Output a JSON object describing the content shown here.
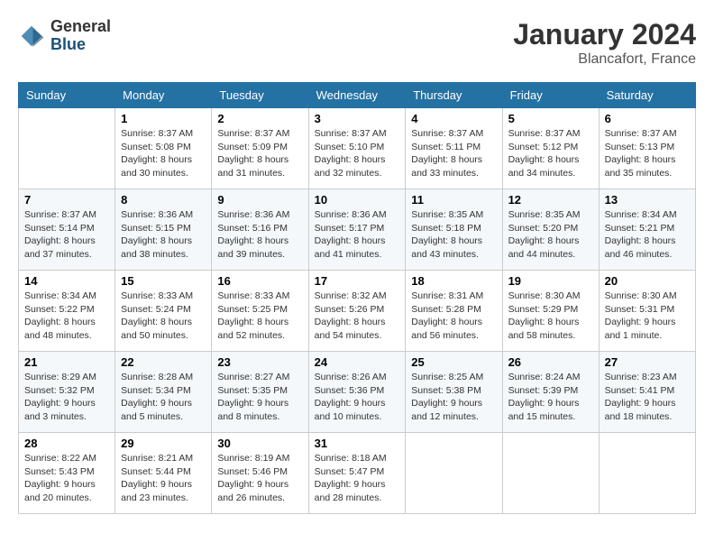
{
  "header": {
    "logo_general": "General",
    "logo_blue": "Blue",
    "month_title": "January 2024",
    "location": "Blancafort, France"
  },
  "days_of_week": [
    "Sunday",
    "Monday",
    "Tuesday",
    "Wednesday",
    "Thursday",
    "Friday",
    "Saturday"
  ],
  "weeks": [
    [
      {
        "day": "",
        "info": ""
      },
      {
        "day": "1",
        "info": "Sunrise: 8:37 AM\nSunset: 5:08 PM\nDaylight: 8 hours\nand 30 minutes."
      },
      {
        "day": "2",
        "info": "Sunrise: 8:37 AM\nSunset: 5:09 PM\nDaylight: 8 hours\nand 31 minutes."
      },
      {
        "day": "3",
        "info": "Sunrise: 8:37 AM\nSunset: 5:10 PM\nDaylight: 8 hours\nand 32 minutes."
      },
      {
        "day": "4",
        "info": "Sunrise: 8:37 AM\nSunset: 5:11 PM\nDaylight: 8 hours\nand 33 minutes."
      },
      {
        "day": "5",
        "info": "Sunrise: 8:37 AM\nSunset: 5:12 PM\nDaylight: 8 hours\nand 34 minutes."
      },
      {
        "day": "6",
        "info": "Sunrise: 8:37 AM\nSunset: 5:13 PM\nDaylight: 8 hours\nand 35 minutes."
      }
    ],
    [
      {
        "day": "7",
        "info": "Sunrise: 8:37 AM\nSunset: 5:14 PM\nDaylight: 8 hours\nand 37 minutes."
      },
      {
        "day": "8",
        "info": "Sunrise: 8:36 AM\nSunset: 5:15 PM\nDaylight: 8 hours\nand 38 minutes."
      },
      {
        "day": "9",
        "info": "Sunrise: 8:36 AM\nSunset: 5:16 PM\nDaylight: 8 hours\nand 39 minutes."
      },
      {
        "day": "10",
        "info": "Sunrise: 8:36 AM\nSunset: 5:17 PM\nDaylight: 8 hours\nand 41 minutes."
      },
      {
        "day": "11",
        "info": "Sunrise: 8:35 AM\nSunset: 5:18 PM\nDaylight: 8 hours\nand 43 minutes."
      },
      {
        "day": "12",
        "info": "Sunrise: 8:35 AM\nSunset: 5:20 PM\nDaylight: 8 hours\nand 44 minutes."
      },
      {
        "day": "13",
        "info": "Sunrise: 8:34 AM\nSunset: 5:21 PM\nDaylight: 8 hours\nand 46 minutes."
      }
    ],
    [
      {
        "day": "14",
        "info": "Sunrise: 8:34 AM\nSunset: 5:22 PM\nDaylight: 8 hours\nand 48 minutes."
      },
      {
        "day": "15",
        "info": "Sunrise: 8:33 AM\nSunset: 5:24 PM\nDaylight: 8 hours\nand 50 minutes."
      },
      {
        "day": "16",
        "info": "Sunrise: 8:33 AM\nSunset: 5:25 PM\nDaylight: 8 hours\nand 52 minutes."
      },
      {
        "day": "17",
        "info": "Sunrise: 8:32 AM\nSunset: 5:26 PM\nDaylight: 8 hours\nand 54 minutes."
      },
      {
        "day": "18",
        "info": "Sunrise: 8:31 AM\nSunset: 5:28 PM\nDaylight: 8 hours\nand 56 minutes."
      },
      {
        "day": "19",
        "info": "Sunrise: 8:30 AM\nSunset: 5:29 PM\nDaylight: 8 hours\nand 58 minutes."
      },
      {
        "day": "20",
        "info": "Sunrise: 8:30 AM\nSunset: 5:31 PM\nDaylight: 9 hours\nand 1 minute."
      }
    ],
    [
      {
        "day": "21",
        "info": "Sunrise: 8:29 AM\nSunset: 5:32 PM\nDaylight: 9 hours\nand 3 minutes."
      },
      {
        "day": "22",
        "info": "Sunrise: 8:28 AM\nSunset: 5:34 PM\nDaylight: 9 hours\nand 5 minutes."
      },
      {
        "day": "23",
        "info": "Sunrise: 8:27 AM\nSunset: 5:35 PM\nDaylight: 9 hours\nand 8 minutes."
      },
      {
        "day": "24",
        "info": "Sunrise: 8:26 AM\nSunset: 5:36 PM\nDaylight: 9 hours\nand 10 minutes."
      },
      {
        "day": "25",
        "info": "Sunrise: 8:25 AM\nSunset: 5:38 PM\nDaylight: 9 hours\nand 12 minutes."
      },
      {
        "day": "26",
        "info": "Sunrise: 8:24 AM\nSunset: 5:39 PM\nDaylight: 9 hours\nand 15 minutes."
      },
      {
        "day": "27",
        "info": "Sunrise: 8:23 AM\nSunset: 5:41 PM\nDaylight: 9 hours\nand 18 minutes."
      }
    ],
    [
      {
        "day": "28",
        "info": "Sunrise: 8:22 AM\nSunset: 5:43 PM\nDaylight: 9 hours\nand 20 minutes."
      },
      {
        "day": "29",
        "info": "Sunrise: 8:21 AM\nSunset: 5:44 PM\nDaylight: 9 hours\nand 23 minutes."
      },
      {
        "day": "30",
        "info": "Sunrise: 8:19 AM\nSunset: 5:46 PM\nDaylight: 9 hours\nand 26 minutes."
      },
      {
        "day": "31",
        "info": "Sunrise: 8:18 AM\nSunset: 5:47 PM\nDaylight: 9 hours\nand 28 minutes."
      },
      {
        "day": "",
        "info": ""
      },
      {
        "day": "",
        "info": ""
      },
      {
        "day": "",
        "info": ""
      }
    ]
  ]
}
